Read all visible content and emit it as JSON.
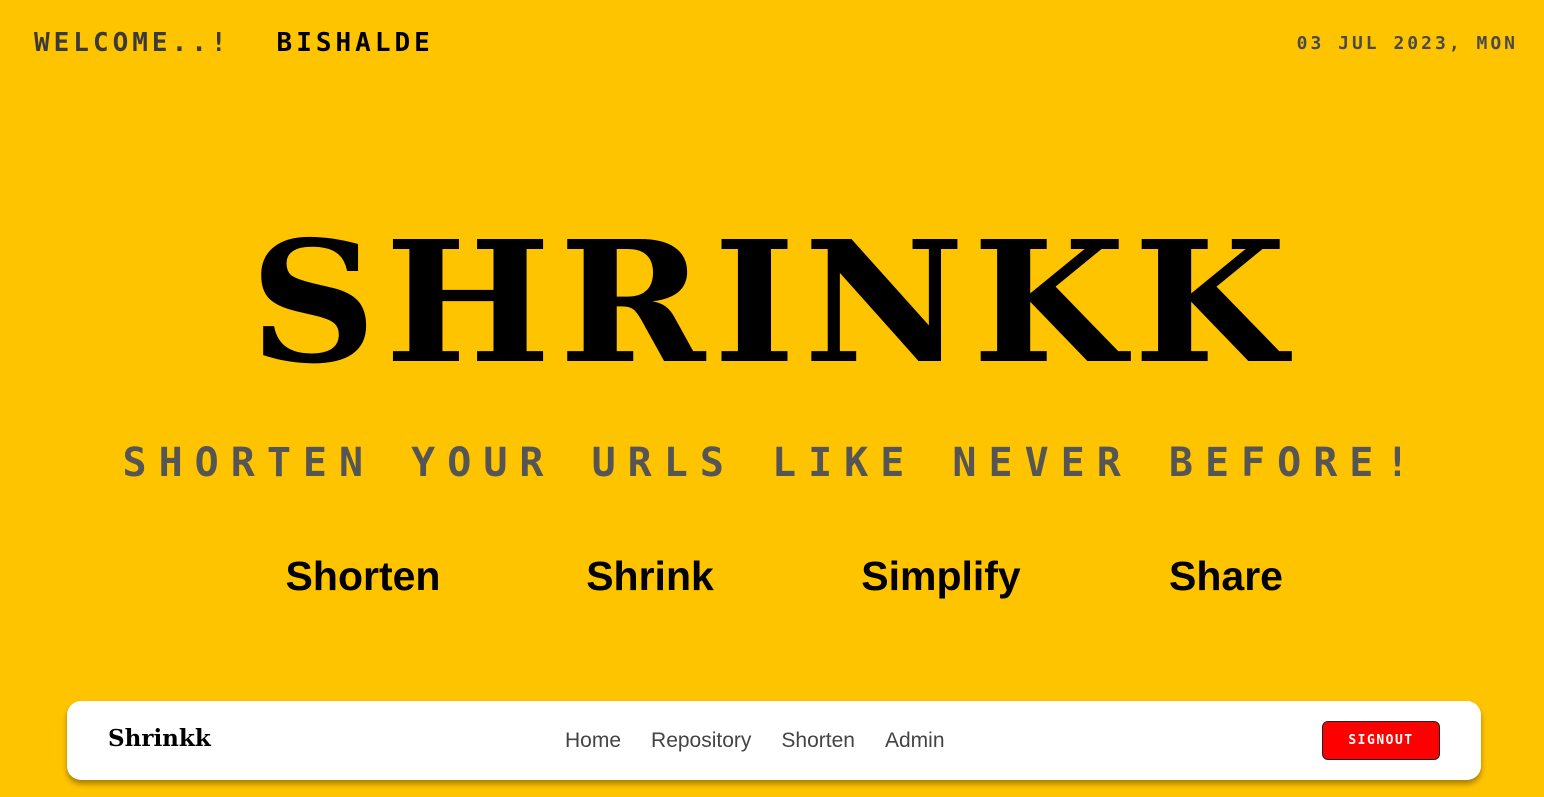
{
  "header": {
    "welcome": "WELCOME..!",
    "username": "BISHALDE",
    "date": "03 JUL 2023, MON"
  },
  "hero": {
    "title": "SHRINKK",
    "tagline": "SHORTEN YOUR URLS LIKE NEVER BEFORE!"
  },
  "features": [
    "Shorten",
    "Shrink",
    "Simplify",
    "Share"
  ],
  "navbar": {
    "brand": "Shrinkk",
    "links": [
      "Home",
      "Repository",
      "Shorten",
      "Admin"
    ],
    "signout_label": "SIGNOUT"
  },
  "colors": {
    "background": "#FFC400",
    "signout": "#FF0000",
    "tagline": "#555555",
    "navbar_bg": "#FFFFFF"
  }
}
